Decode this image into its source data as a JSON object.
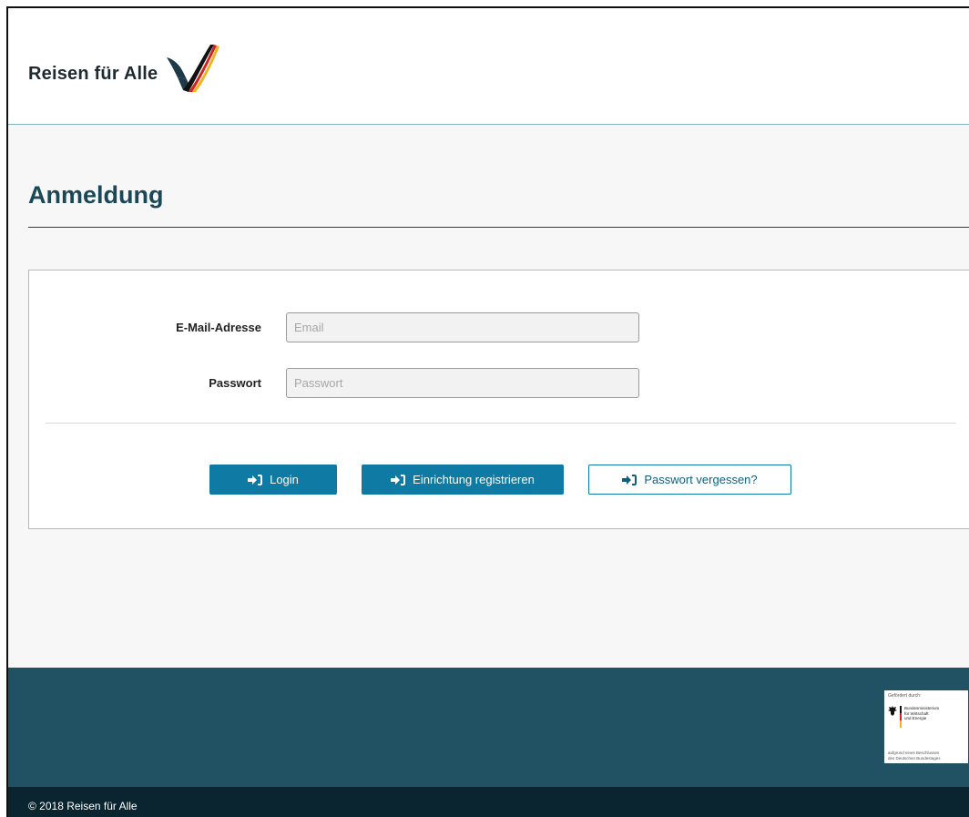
{
  "brand": {
    "name": "Reisen für Alle",
    "logo_icon": "check-swoosh-logo",
    "colors": {
      "dark": "#1e3a48",
      "black": "#111111",
      "red": "#d21f1f",
      "gold": "#f2b21a"
    }
  },
  "page": {
    "title": "Anmeldung"
  },
  "form": {
    "email": {
      "label": "E-Mail-Adresse",
      "placeholder": "Email",
      "value": ""
    },
    "password": {
      "label": "Passwort",
      "placeholder": "Passwort",
      "value": ""
    },
    "buttons": {
      "login": {
        "label": "Login",
        "icon": "sign-in-icon"
      },
      "register": {
        "label": "Einrichtung registrieren",
        "icon": "sign-in-icon"
      },
      "forgot": {
        "label": "Passwort vergessen?",
        "icon": "sign-in-icon"
      }
    }
  },
  "footer": {
    "funder": {
      "top_text": "Gefördert durch:",
      "ministry_line1": "Bundesministerium",
      "ministry_line2": "für Wirtschaft",
      "ministry_line3": "und Energie",
      "bottom_line1": "aufgrund eines Beschlusses",
      "bottom_line2": "des Deutschen Bundestages"
    },
    "copyright": "© 2018 Reisen für Alle"
  },
  "colors": {
    "accent": "#0f7aa3",
    "title": "#1a4858",
    "footer_bg": "#205264",
    "bottom_bar": "#0b2530"
  }
}
